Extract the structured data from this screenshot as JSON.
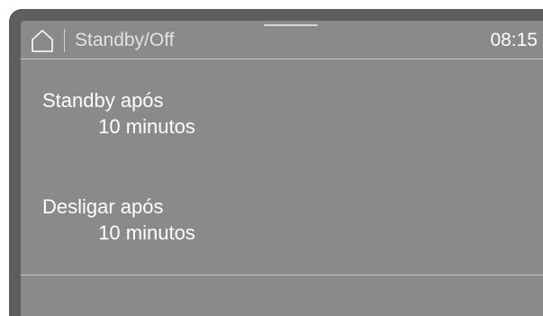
{
  "header": {
    "home_icon": "home-icon",
    "title": "Standby/Off",
    "time": "08:15"
  },
  "settings": [
    {
      "label": "Standby após",
      "value": "10 minutos"
    },
    {
      "label": "Desligar após",
      "value": "10 minutos"
    }
  ],
  "colors": {
    "bezel": "#5e5e5e",
    "screen_bg": "#8a8a8a",
    "text": "#ffffff",
    "divider": "#c4c4c4"
  }
}
